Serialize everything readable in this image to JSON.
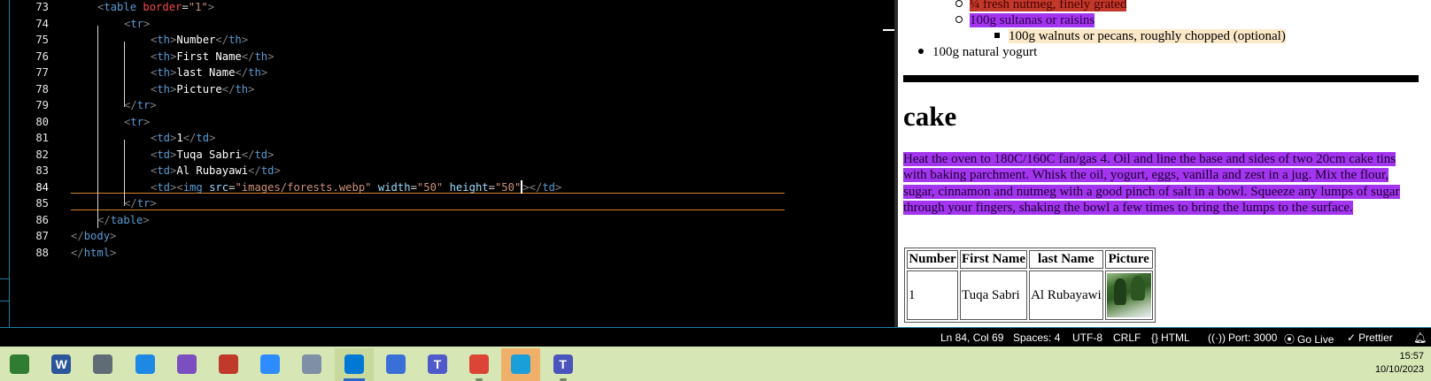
{
  "editor": {
    "lines": [
      {
        "num": "73",
        "segs": [
          [
            "t-punc",
            "<"
          ],
          [
            "t-tag",
            "table "
          ],
          [
            "t-attr-red",
            "border"
          ],
          [
            "t-eq",
            "="
          ],
          [
            "t-str",
            "\"1\""
          ],
          [
            "t-punc",
            ">"
          ]
        ]
      },
      {
        "num": "74",
        "segs": [
          [
            "t-punc",
            "<"
          ],
          [
            "t-tag",
            "tr"
          ],
          [
            "t-punc",
            ">"
          ]
        ]
      },
      {
        "num": "75",
        "segs": [
          [
            "t-punc",
            "<"
          ],
          [
            "t-tag",
            "th"
          ],
          [
            "t-punc",
            ">"
          ],
          [
            "t-txt",
            "Number"
          ],
          [
            "t-punc",
            "</"
          ],
          [
            "t-tag",
            "th"
          ],
          [
            "t-punc",
            ">"
          ]
        ]
      },
      {
        "num": "76",
        "segs": [
          [
            "t-punc",
            "<"
          ],
          [
            "t-tag",
            "th"
          ],
          [
            "t-punc",
            ">"
          ],
          [
            "t-txt",
            "First Name"
          ],
          [
            "t-punc",
            "</"
          ],
          [
            "t-tag",
            "th"
          ],
          [
            "t-punc",
            ">"
          ]
        ]
      },
      {
        "num": "77",
        "segs": [
          [
            "t-punc",
            "<"
          ],
          [
            "t-tag",
            "th"
          ],
          [
            "t-punc",
            ">"
          ],
          [
            "t-txt",
            "last Name"
          ],
          [
            "t-punc",
            "</"
          ],
          [
            "t-tag",
            "th"
          ],
          [
            "t-punc",
            ">"
          ]
        ]
      },
      {
        "num": "78",
        "segs": [
          [
            "t-punc",
            "<"
          ],
          [
            "t-tag",
            "th"
          ],
          [
            "t-punc",
            ">"
          ],
          [
            "t-txt",
            "Picture"
          ],
          [
            "t-punc",
            "</"
          ],
          [
            "t-tag",
            "th"
          ],
          [
            "t-punc",
            ">"
          ]
        ]
      },
      {
        "num": "79",
        "segs": [
          [
            "t-punc",
            "</"
          ],
          [
            "t-tag",
            "tr"
          ],
          [
            "t-punc",
            ">"
          ]
        ]
      },
      {
        "num": "80",
        "segs": [
          [
            "t-punc",
            "<"
          ],
          [
            "t-tag",
            "tr"
          ],
          [
            "t-punc",
            ">"
          ]
        ]
      },
      {
        "num": "81",
        "segs": [
          [
            "t-punc",
            "<"
          ],
          [
            "t-tag",
            "td"
          ],
          [
            "t-punc",
            ">"
          ],
          [
            "t-txt",
            "1"
          ],
          [
            "t-punc",
            "</"
          ],
          [
            "t-tag",
            "td"
          ],
          [
            "t-punc",
            ">"
          ]
        ]
      },
      {
        "num": "82",
        "segs": [
          [
            "t-punc",
            "<"
          ],
          [
            "t-tag",
            "td"
          ],
          [
            "t-punc",
            ">"
          ],
          [
            "t-txt",
            "Tuqa Sabri"
          ],
          [
            "t-punc",
            "</"
          ],
          [
            "t-tag",
            "td"
          ],
          [
            "t-punc",
            ">"
          ]
        ]
      },
      {
        "num": "83",
        "segs": [
          [
            "t-punc",
            "<"
          ],
          [
            "t-tag",
            "td"
          ],
          [
            "t-punc",
            ">"
          ],
          [
            "t-txt",
            "Al Rubayawi"
          ],
          [
            "t-punc",
            "</"
          ],
          [
            "t-tag",
            "td"
          ],
          [
            "t-punc",
            ">"
          ]
        ]
      },
      {
        "num": "84",
        "segs": [
          [
            "t-punc",
            "<"
          ],
          [
            "t-tag",
            "td"
          ],
          [
            "t-punc",
            "><"
          ],
          [
            "t-tag",
            "img "
          ],
          [
            "t-attr",
            "src"
          ],
          [
            "t-eq",
            "="
          ],
          [
            "t-str",
            "\"images/forests.webp\" "
          ],
          [
            "t-attr",
            "width"
          ],
          [
            "t-eq",
            "="
          ],
          [
            "t-str",
            "\"50\" "
          ],
          [
            "t-attr",
            "height"
          ],
          [
            "t-eq",
            "="
          ],
          [
            "t-str",
            "\"50\""
          ],
          [
            "t-punc",
            "></"
          ],
          [
            "t-tag",
            "td"
          ],
          [
            "t-punc",
            ">"
          ]
        ]
      },
      {
        "num": "85",
        "segs": [
          [
            "t-punc",
            "</"
          ],
          [
            "t-tag",
            "tr"
          ],
          [
            "t-punc",
            ">"
          ]
        ]
      },
      {
        "num": "86",
        "segs": [
          [
            "t-punc",
            "</"
          ],
          [
            "t-tag",
            "table"
          ],
          [
            "t-punc",
            ">"
          ]
        ]
      },
      {
        "num": "87",
        "segs": [
          [
            "t-punc",
            "</"
          ],
          [
            "t-tag",
            "body"
          ],
          [
            "t-punc",
            ">"
          ]
        ]
      },
      {
        "num": "88",
        "segs": [
          [
            "t-punc",
            "</"
          ],
          [
            "t-tag",
            "html"
          ],
          [
            "t-punc",
            ">"
          ]
        ]
      }
    ],
    "active_line": "84"
  },
  "preview": {
    "list_items": [
      {
        "text": "¼ fresh nutmeg, finely grated",
        "style": "hl-red",
        "bullet": "hollow"
      },
      {
        "text": "100g sultanas or raisins",
        "style": "hl-purple",
        "bullet": "hollow"
      },
      {
        "text": "100g walnuts or pecans, roughly chopped (optional)",
        "style": "hl-cream",
        "bullet": "square"
      },
      {
        "text": "100g natural yogurt",
        "style": "",
        "bullet": "disc"
      }
    ],
    "heading": "cake",
    "paragraph": "Heat the oven to 180C/160C fan/gas 4. Oil and line the base and sides of two 20cm cake tins with baking parchment. Whisk the oil, yogurt, eggs, vanilla and zest in a jug. Mix the flour, sugar, cinnamon and nutmeg with a good pinch of salt in a bowl. Squeeze any lumps of sugar through your fingers, shaking the bowl a few times to bring the lumps to the surface.",
    "table": {
      "headers": [
        "Number",
        "First Name",
        "last Name",
        "Picture"
      ],
      "row": [
        "1",
        "Tuqa Sabri",
        "Al Rubayawi"
      ]
    }
  },
  "statusbar": {
    "position": "Ln 84, Col 69",
    "spaces": "Spaces: 4",
    "encoding": "UTF-8",
    "eol": "CRLF",
    "language": "HTML",
    "port": "Port: 3000",
    "golive": "Go Live",
    "prettier": "Prettier"
  },
  "taskbar": {
    "apps": [
      {
        "name": "app-ribbon",
        "letter": "",
        "color": "#2e7d32",
        "state": ""
      },
      {
        "name": "word",
        "letter": "W",
        "color": "#2b579a",
        "state": ""
      },
      {
        "name": "calculator",
        "letter": "",
        "color": "#5f6b75",
        "state": ""
      },
      {
        "name": "store",
        "letter": "",
        "color": "#1e88e5",
        "state": ""
      },
      {
        "name": "visual-studio",
        "letter": "",
        "color": "#7b4fc0",
        "state": ""
      },
      {
        "name": "snipping-tool",
        "letter": "",
        "color": "#c0392b",
        "state": ""
      },
      {
        "name": "zoom",
        "letter": "",
        "color": "#2d8cff",
        "state": ""
      },
      {
        "name": "photos",
        "letter": "",
        "color": "#7f8fa6",
        "state": ""
      },
      {
        "name": "vscode",
        "letter": "",
        "color": "#0078d4",
        "state": "active"
      },
      {
        "name": "copilot",
        "letter": "",
        "color": "#3a6fd8",
        "state": ""
      },
      {
        "name": "teams-classic",
        "letter": "T",
        "color": "#5059c9",
        "state": ""
      },
      {
        "name": "chrome",
        "letter": "",
        "color": "#db4437",
        "state": "open"
      },
      {
        "name": "edge",
        "letter": "",
        "color": "#1a9fd8",
        "state": "active-orange"
      },
      {
        "name": "teams",
        "letter": "T",
        "color": "#4b53bc",
        "state": "open"
      }
    ],
    "time": "15:57",
    "date": "10/10/2023"
  }
}
